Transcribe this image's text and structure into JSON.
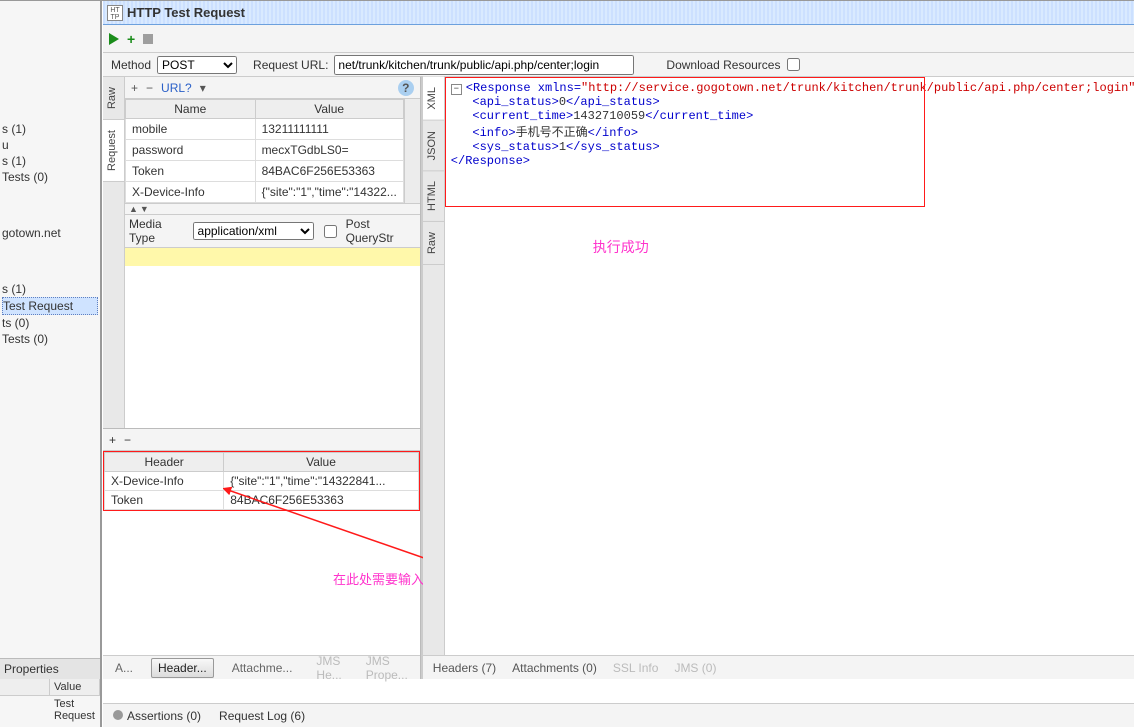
{
  "window": {
    "title": "HTTP Test Request",
    "icon_text": "HT\nTP"
  },
  "method": {
    "label": "Method",
    "value": "POST"
  },
  "url": {
    "label": "Request URL:",
    "value": "net/trunk/kitchen/trunk/public/api.php/center;login"
  },
  "download_resources": {
    "label": "Download Resources",
    "checked": false
  },
  "params_table": {
    "headers": {
      "name": "Name",
      "value": "Value"
    },
    "rows": [
      {
        "name": "mobile",
        "value": "13211111111"
      },
      {
        "name": "password",
        "value": "mecxTGdbLS0="
      },
      {
        "name": "Token",
        "value": "84BAC6F256E53363"
      },
      {
        "name": "X-Device-Info",
        "value": "{\"site\":\"1\",\"time\":\"14322..."
      }
    ]
  },
  "media_type": {
    "label": "Media Type",
    "value": "application/xml"
  },
  "post_qs": {
    "label": "Post QueryStr"
  },
  "vtab_left": {
    "raw": "Raw",
    "request": "Request"
  },
  "vtab_right": {
    "raw": "Raw",
    "html": "HTML",
    "json": "JSON",
    "xml": "XML"
  },
  "headers_table": {
    "headers": {
      "name": "Header",
      "value": "Value"
    },
    "rows": [
      {
        "name": "X-Device-Info",
        "value": "{\"site\":\"1\",\"time\":\"14322841..."
      },
      {
        "name": "Token",
        "value": "84BAC6F256E53363"
      }
    ]
  },
  "left_sidebar": {
    "items_a": [
      "",
      "s (1)",
      "u",
      "s (1)",
      "Tests (0)",
      "",
      "gotown.net"
    ],
    "items_b": [
      "",
      "s (1)",
      "Test Request",
      "ts (0)",
      "Tests (0)"
    ],
    "selected_b": 2,
    "properties_title": "Properties",
    "prop_head_value": "Value",
    "prop_row_name": "Test Request"
  },
  "req_tabs": {
    "a": "A...",
    "headers": "Header...",
    "attachme": "Attachme...",
    "jms_he": "JMS He...",
    "jms_prope": "JMS Prope..."
  },
  "resp_tabs": {
    "headers": "Headers (7)",
    "attachments": "Attachments (0)",
    "ssl": "SSL Info",
    "jms": "JMS (0)"
  },
  "response_xml": {
    "root_open": "Response",
    "xmlns_name": "xmlns",
    "xmlns_val": "\"http://service.gogotown.net/trunk/kitchen/trunk/public/api.php/center;login\"",
    "api_status_tag": "api_status",
    "api_status_val": "0",
    "current_time_tag": "current_time",
    "current_time_val": "1432710059",
    "info_tag": "info",
    "info_val": "手机号不正确",
    "sys_status_tag": "sys_status",
    "sys_status_val": "1",
    "close": "Response"
  },
  "annotations": {
    "success": "执行成功",
    "header_note": "在此处需要输入header：header由token和X-device—info组成"
  },
  "bottom": {
    "assertions": "Assertions (0)",
    "request_log": "Request Log (6)"
  }
}
